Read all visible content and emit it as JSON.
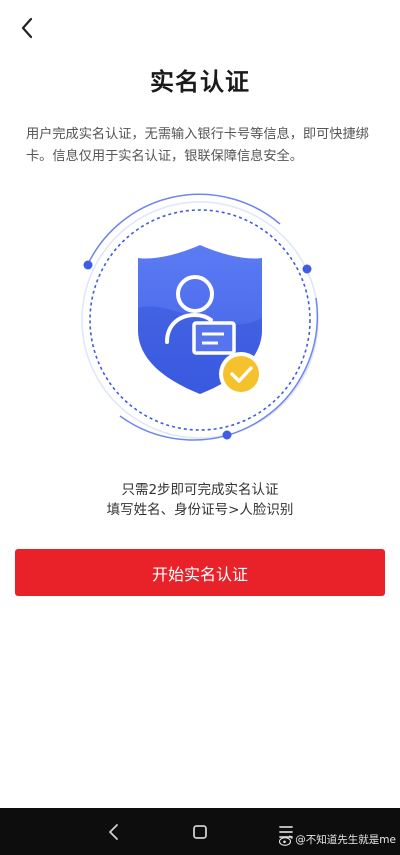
{
  "header": {
    "title": "实名认证"
  },
  "description": "用户完成实名认证，无需输入银行卡号等信息，即可快捷绑卡。信息仅用于实名认证，银联保障信息安全。",
  "hints": {
    "line1": "只需2步即可完成实名认证",
    "line2": "填写姓名、身份证号>人脸识别"
  },
  "actions": {
    "start_label": "开始实名认证"
  },
  "colors": {
    "accent": "#e9222a",
    "shield": "#4a6cf0",
    "check": "#f5c12c"
  },
  "icons": [
    "back-arrow-icon",
    "shield-id-icon",
    "check-icon",
    "nav-back-icon",
    "nav-home-icon",
    "nav-menu-icon",
    "weibo-icon"
  ],
  "watermark": {
    "text": "@不知道先生就是me"
  }
}
